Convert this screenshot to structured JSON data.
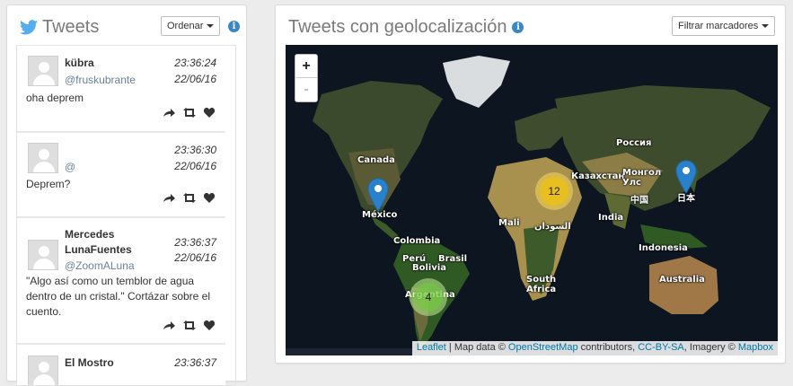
{
  "tweets_panel": {
    "title": "Tweets",
    "sort_button": "Ordenar",
    "tweets": [
      {
        "name": "kübra",
        "handle": "@fruskubrante",
        "time": "23:36:24",
        "date": "22/06/16",
        "text": "oha deprem"
      },
      {
        "name": "",
        "handle": "@",
        "time": "23:36:30",
        "date": "22/06/16",
        "text": "Deprem?"
      },
      {
        "name": "Mercedes LunaFuentes",
        "handle": "@ZoomALuna",
        "time": "23:36:37",
        "date": "22/06/16",
        "text": "\"Algo así como un temblor de agua dentro de un cristal.\" Cortázar sobre el cuento."
      },
      {
        "name": "El Mostro",
        "handle": "",
        "time": "23:36:37",
        "date": "",
        "text": ""
      }
    ]
  },
  "geo_panel": {
    "title": "Tweets con geolocalización",
    "filter_button": "Filtrar marcadores",
    "zoom_in": "+",
    "zoom_out": "-",
    "clusters": [
      {
        "count": "12",
        "color": "#f1d357"
      },
      {
        "count": "4",
        "color": "#6ecc39"
      }
    ],
    "map_labels": {
      "russia": "Россия",
      "canada": "Canada",
      "kazakhstan": "Казахстан",
      "mongolia": "Монгол Улс",
      "china": "中国",
      "japan": "日本",
      "mexico": "México",
      "india": "India",
      "mali": "Mali",
      "sudan": "السودان",
      "colombia": "Colombia",
      "peru": "Perú",
      "brasil": "Brasil",
      "bolivia": "Bolivia",
      "argentina": "Argentina",
      "indonesia": "Indonesia",
      "south_africa": "South Africa",
      "australia": "Australia"
    },
    "attribution": {
      "leaflet": "Leaflet",
      "sep1": " | Map data © ",
      "osm": "OpenStreetMap",
      "contributors": " contributors, ",
      "license": "CC-BY-SA",
      "imagery": ", Imagery © ",
      "mapbox": "Mapbox"
    }
  },
  "colors": {
    "twitter_blue": "#55acee",
    "info_blue": "#3a87c5",
    "marker_blue": "#2a81cb",
    "link_blue": "#0078a8"
  },
  "icons": [
    "twitter-bird-icon",
    "info-icon",
    "reply-icon",
    "retweet-icon",
    "heart-icon",
    "map-marker-icon"
  ]
}
